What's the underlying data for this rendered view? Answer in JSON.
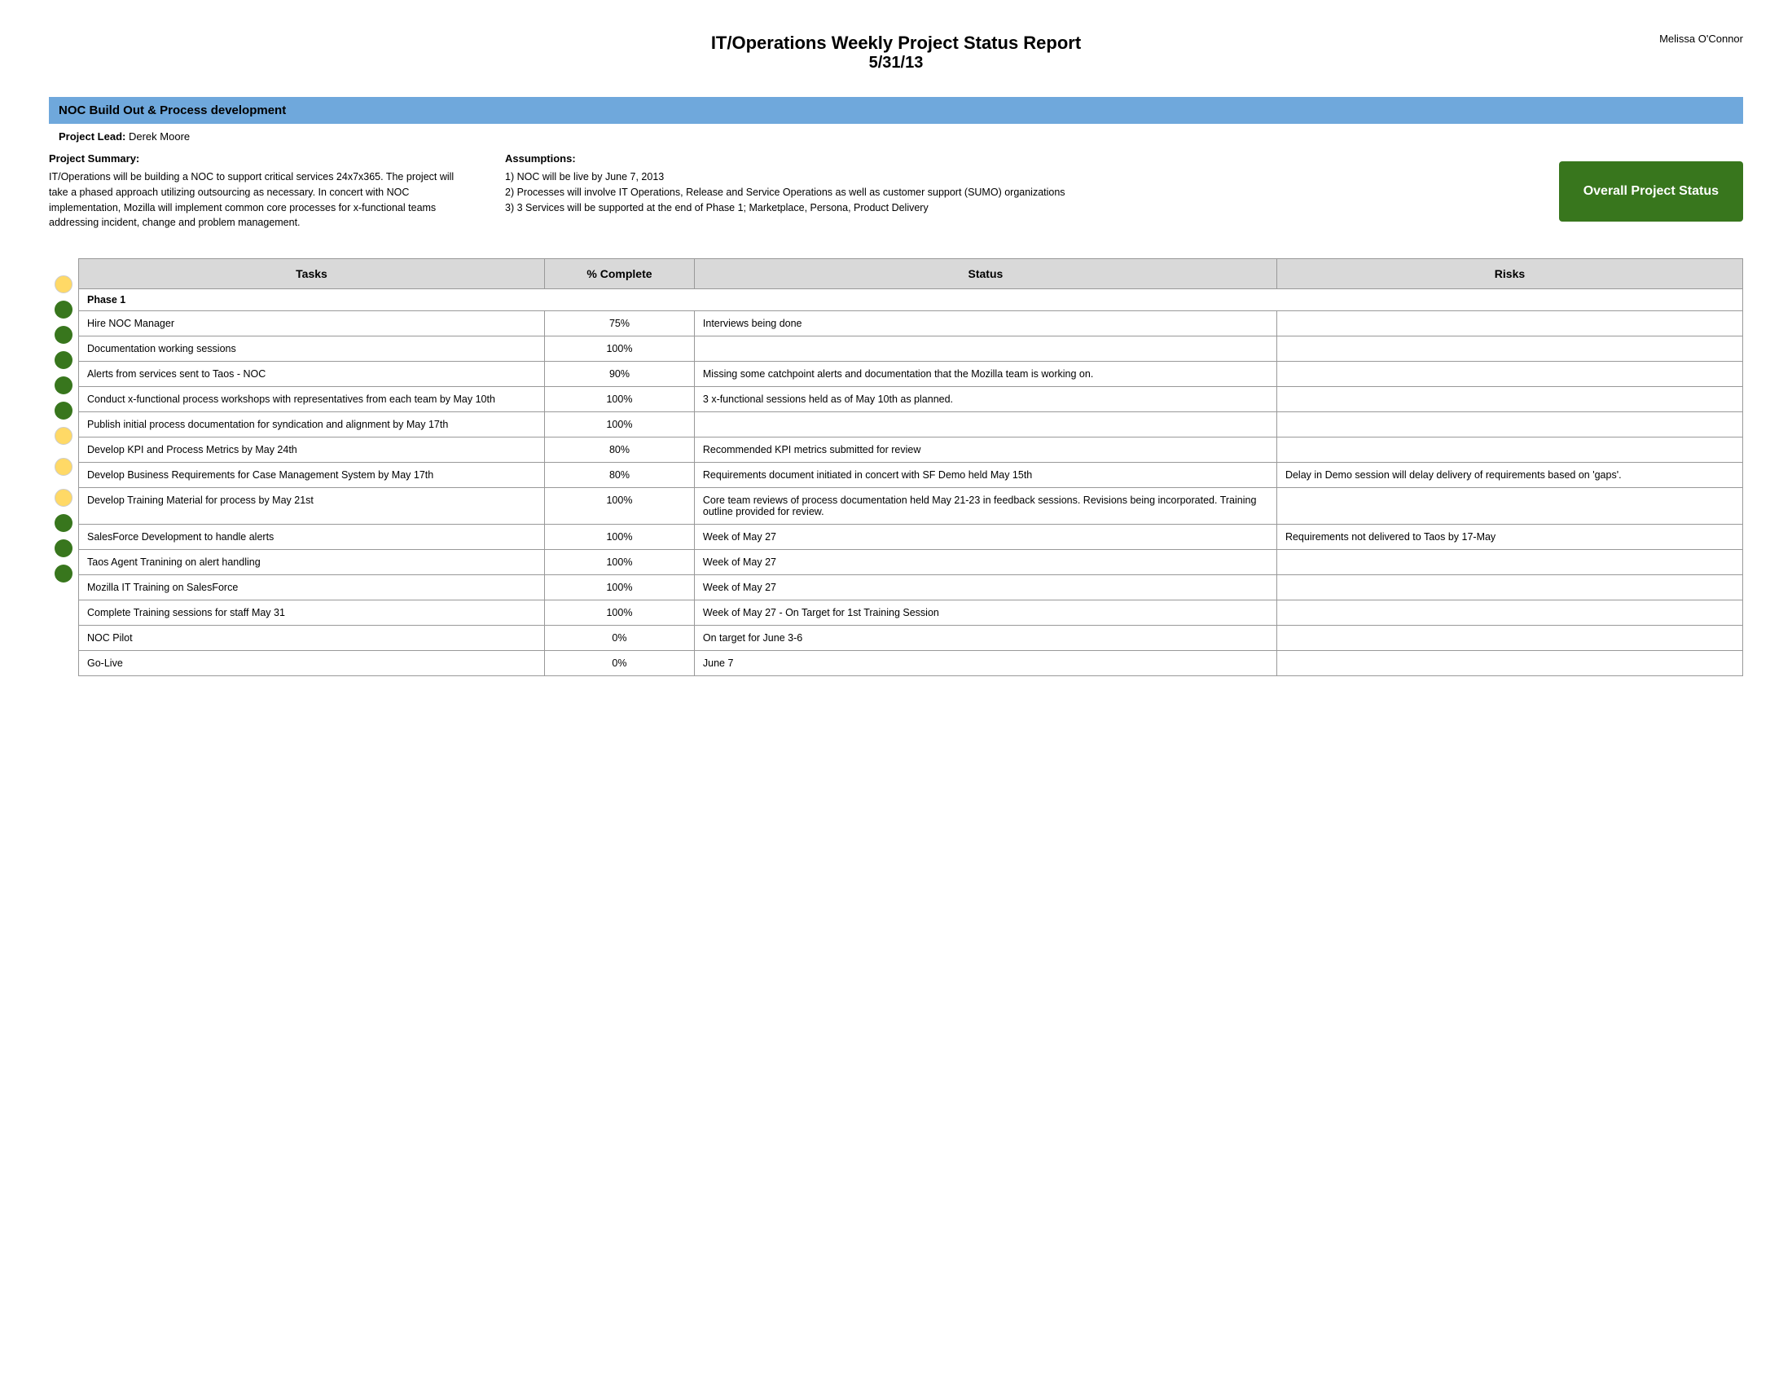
{
  "header": {
    "title_line1": "IT/Operations Weekly Project Status Report",
    "title_line2": "5/31/13",
    "author": "Melissa O'Connor"
  },
  "project": {
    "title": "NOC Build Out & Process development",
    "lead_label": "Project Lead:",
    "lead_name": "Derek Moore"
  },
  "summary": {
    "left_title": "Project Summary:",
    "left_text": "IT/Operations will be building a NOC to support critical services 24x7x365. The project will take a phased approach utilizing outsourcing as necessary.  In concert with NOC implementation, Mozilla will implement common core processes for x-functional teams addressing incident, change and problem management.",
    "right_title": "Assumptions:",
    "right_text": "1) NOC will be live by June 7, 2013\n2) Processes will involve IT Operations, Release and Service Operations as well as customer support (SUMO) organizations\n3) 3 Services will be supported at the end of Phase 1; Marketplace, Persona, Product Delivery"
  },
  "overall_status": {
    "label": "Overall Project Status",
    "color": "#38761d"
  },
  "table": {
    "headers": [
      "Tasks",
      "% Complete",
      "Status",
      "Risks"
    ],
    "phase1_label": "Phase 1",
    "rows": [
      {
        "indicator": "yellow",
        "task": "Hire NOC Manager",
        "complete": "75%",
        "status": "Interviews being done",
        "risks": ""
      },
      {
        "indicator": "green",
        "task": "Documentation working sessions",
        "complete": "100%",
        "status": "",
        "risks": ""
      },
      {
        "indicator": "green",
        "task": "Alerts from services sent to Taos - NOC",
        "complete": "90%",
        "status": "Missing some catchpoint alerts and documentation that the Mozilla team is working on.",
        "risks": ""
      },
      {
        "indicator": "green",
        "task": "Conduct x-functional process workshops with representatives from each team by May 10th",
        "complete": "100%",
        "status": "3 x-functional sessions held as of May 10th as planned.",
        "risks": ""
      },
      {
        "indicator": "green",
        "task": "Publish initial process documentation for syndication and alignment by May 17th",
        "complete": "100%",
        "status": "",
        "risks": ""
      },
      {
        "indicator": "green",
        "task": "Develop KPI and Process Metrics by May 24th",
        "complete": "80%",
        "status": "Recommended KPI metrics submitted for review",
        "risks": ""
      },
      {
        "indicator": "yellow",
        "task": "Develop Business Requirements for Case Management System by May 17th",
        "complete": "80%",
        "status": "Requirements document initiated in concert with SF Demo held May 15th",
        "risks": "Delay in Demo session will delay delivery of requirements based on 'gaps'."
      },
      {
        "indicator": "yellow",
        "task": "Develop Training Material for process by May 21st",
        "complete": "100%",
        "status": "Core team reviews of process documentation held May 21-23 in feedback sessions. Revisions being incorporated. Training outline provided for review.",
        "risks": ""
      },
      {
        "indicator": "yellow",
        "task": "SalesForce Development to handle alerts",
        "complete": "100%",
        "status": "Week of May 27",
        "risks": "Requirements not delivered to Taos by 17-May"
      },
      {
        "indicator": "green",
        "task": "Taos Agent Tranining on alert handling",
        "complete": "100%",
        "status": "Week of May 27",
        "risks": ""
      },
      {
        "indicator": "green",
        "task": "Mozilla IT Training on SalesForce",
        "complete": "100%",
        "status": "Week of May 27",
        "risks": ""
      },
      {
        "indicator": "green",
        "task": "Complete Training sessions for staff May 31",
        "complete": "100%",
        "status": "Week of May 27  - On Target for 1st Training Session",
        "risks": ""
      },
      {
        "indicator": "none",
        "task": "NOC Pilot",
        "complete": "0%",
        "status": "On target for June 3-6",
        "risks": ""
      },
      {
        "indicator": "none",
        "task": "Go-Live",
        "complete": "0%",
        "status": "June 7",
        "risks": ""
      }
    ]
  }
}
